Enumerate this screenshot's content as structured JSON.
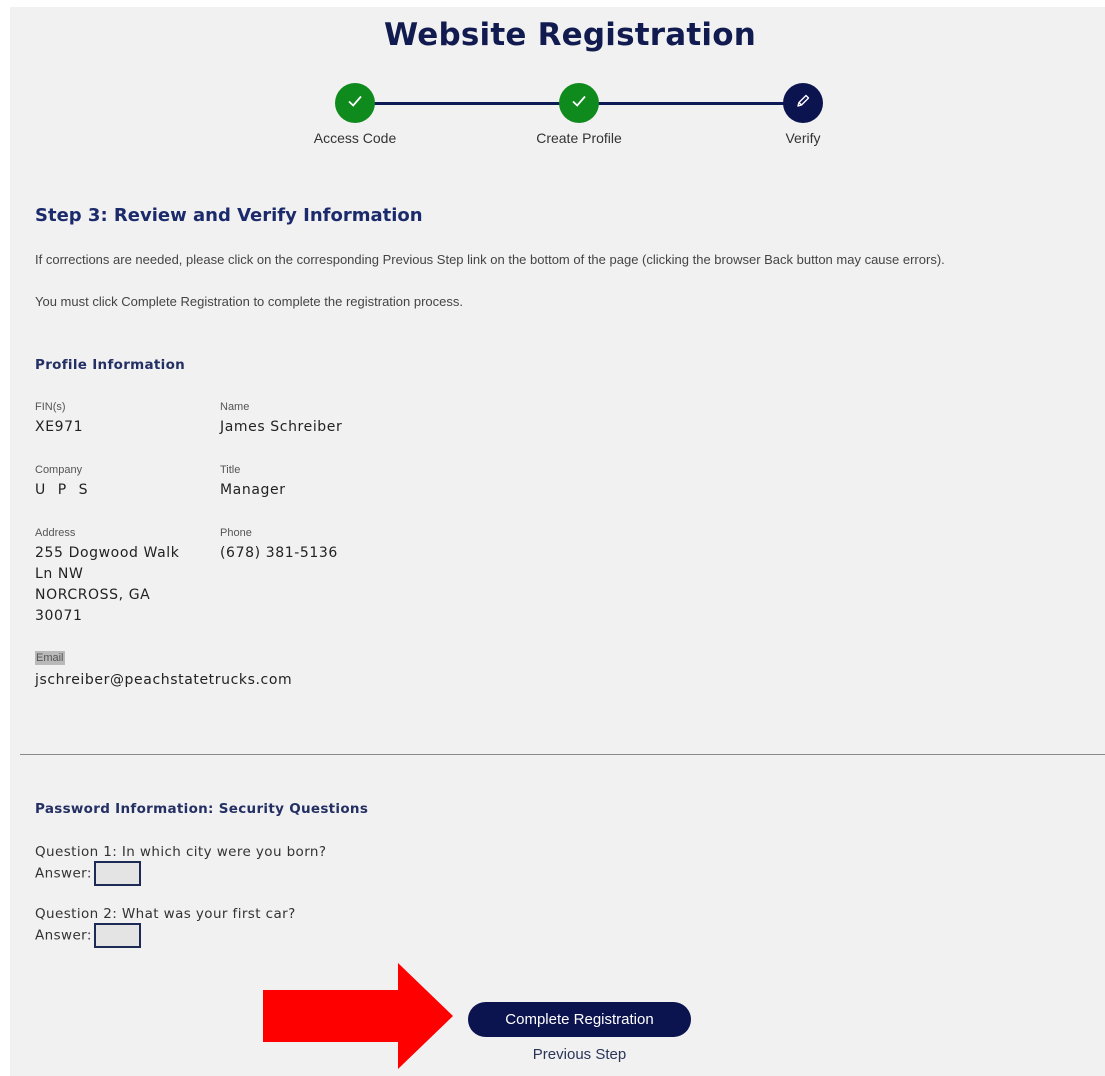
{
  "page": {
    "title": "Website Registration"
  },
  "stepper": {
    "steps": [
      {
        "label": "Access Code",
        "status": "done",
        "icon": "check-icon"
      },
      {
        "label": "Create Profile",
        "status": "done",
        "icon": "check-icon"
      },
      {
        "label": "Verify",
        "status": "current",
        "icon": "pencil-icon"
      }
    ]
  },
  "step_heading": "Step 3: Review and Verify Information",
  "instructions": {
    "line1": "If corrections are needed, please click on the corresponding Previous Step link on the bottom of the page (clicking the browser Back button may cause errors).",
    "line2": "You must click Complete Registration to complete the registration process."
  },
  "profile": {
    "heading": "Profile Information",
    "fins_label": "FIN(s)",
    "fins_value": "XE971",
    "name_label": "Name",
    "name_value": "James Schreiber",
    "company_label": "Company",
    "company_value": "U P S",
    "title_label": "Title",
    "title_value": "Manager",
    "address_label": "Address",
    "address_lines": [
      "255 Dogwood Walk",
      "Ln NW",
      "NORCROSS, GA",
      "30071"
    ],
    "phone_label": "Phone",
    "phone_value": "(678) 381-5136",
    "email_label": "Email",
    "email_value": "jschreiber@peachstatetrucks.com"
  },
  "password": {
    "heading": "Password Information:  Security Questions",
    "q1": "Question 1: In which city were you born?",
    "q2": "Question 2: What was your first car?",
    "answer_label": "Answer:"
  },
  "actions": {
    "complete_label": "Complete Registration",
    "previous_label": "Previous Step"
  },
  "colors": {
    "navy": "#0c1450",
    "green": "#0f8a1d",
    "arrow_red": "#ff0000",
    "background": "#f1f1f1"
  }
}
